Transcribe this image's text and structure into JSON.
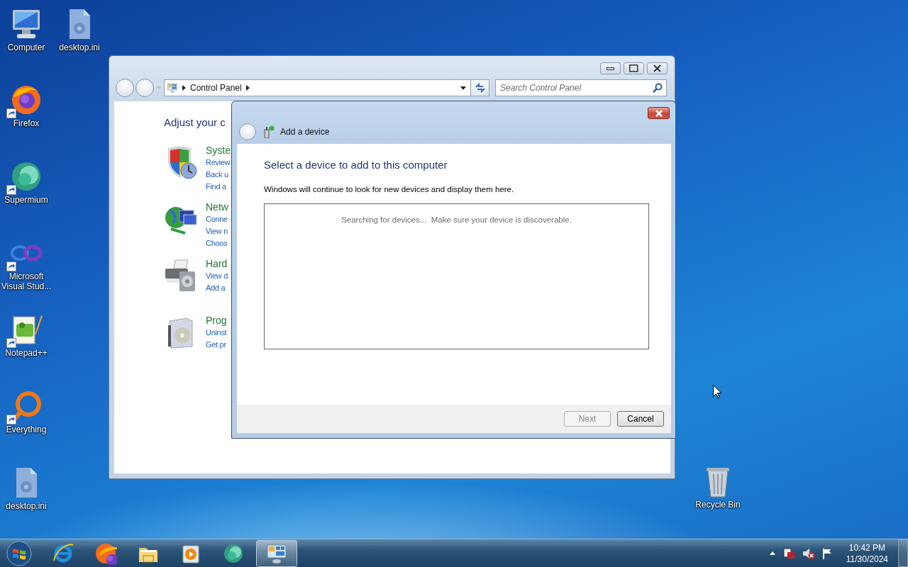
{
  "desktop": {
    "icons": [
      {
        "kind": "computer",
        "label": "Computer",
        "shortcut": false
      },
      {
        "kind": "settings-file",
        "label": "desktop.ini",
        "shortcut": false
      },
      {
        "kind": "firefox",
        "label": "Firefox",
        "shortcut": true
      },
      {
        "kind": "supermium",
        "label": "Supermium",
        "shortcut": true
      },
      {
        "kind": "visual-studio",
        "label": "Microsoft Visual Stud...",
        "shortcut": true
      },
      {
        "kind": "notepadpp",
        "label": "Notepad++",
        "shortcut": true
      },
      {
        "kind": "everything",
        "label": "Everything",
        "shortcut": true
      },
      {
        "kind": "settings-file",
        "label": "desktop.ini",
        "shortcut": false
      },
      {
        "kind": "recycle-bin",
        "label": "Recycle Bin",
        "shortcut": false
      }
    ]
  },
  "control_panel": {
    "address": {
      "crumbs": [
        "Control Panel"
      ]
    },
    "search": {
      "placeholder": "Search Control Panel"
    },
    "heading": "Adjust your c",
    "categories": [
      {
        "kind": "system",
        "title": "Syste",
        "links": [
          "Review",
          "Back u",
          "Find a"
        ]
      },
      {
        "kind": "network",
        "title": "Netw",
        "links": [
          "Conne",
          "View n",
          "Choos"
        ]
      },
      {
        "kind": "hardware",
        "title": "Hard",
        "links": [
          "View d",
          "Add a"
        ]
      },
      {
        "kind": "programs",
        "title": "Prog",
        "links": [
          "Uninst",
          "Get pr"
        ]
      }
    ]
  },
  "dialog": {
    "title": "Add a device",
    "heading": "Select a device to add to this computer",
    "description": "Windows will continue to look for new devices and display them here.",
    "device_list": {
      "message": "Searching for devices...  Make sure your device is discoverable."
    },
    "buttons": [
      {
        "label": "Next",
        "disabled": true
      },
      {
        "label": "Cancel",
        "disabled": false
      }
    ]
  },
  "taskbar": {
    "items": [
      {
        "kind": "ie",
        "active": false
      },
      {
        "kind": "firefox",
        "active": false
      },
      {
        "kind": "explorer",
        "active": false
      },
      {
        "kind": "media-player",
        "active": false
      },
      {
        "kind": "supermium",
        "active": false
      },
      {
        "kind": "control-panel",
        "active": true
      }
    ],
    "clock": {
      "time": "10:42 PM",
      "date": "11/30/2024"
    }
  }
}
